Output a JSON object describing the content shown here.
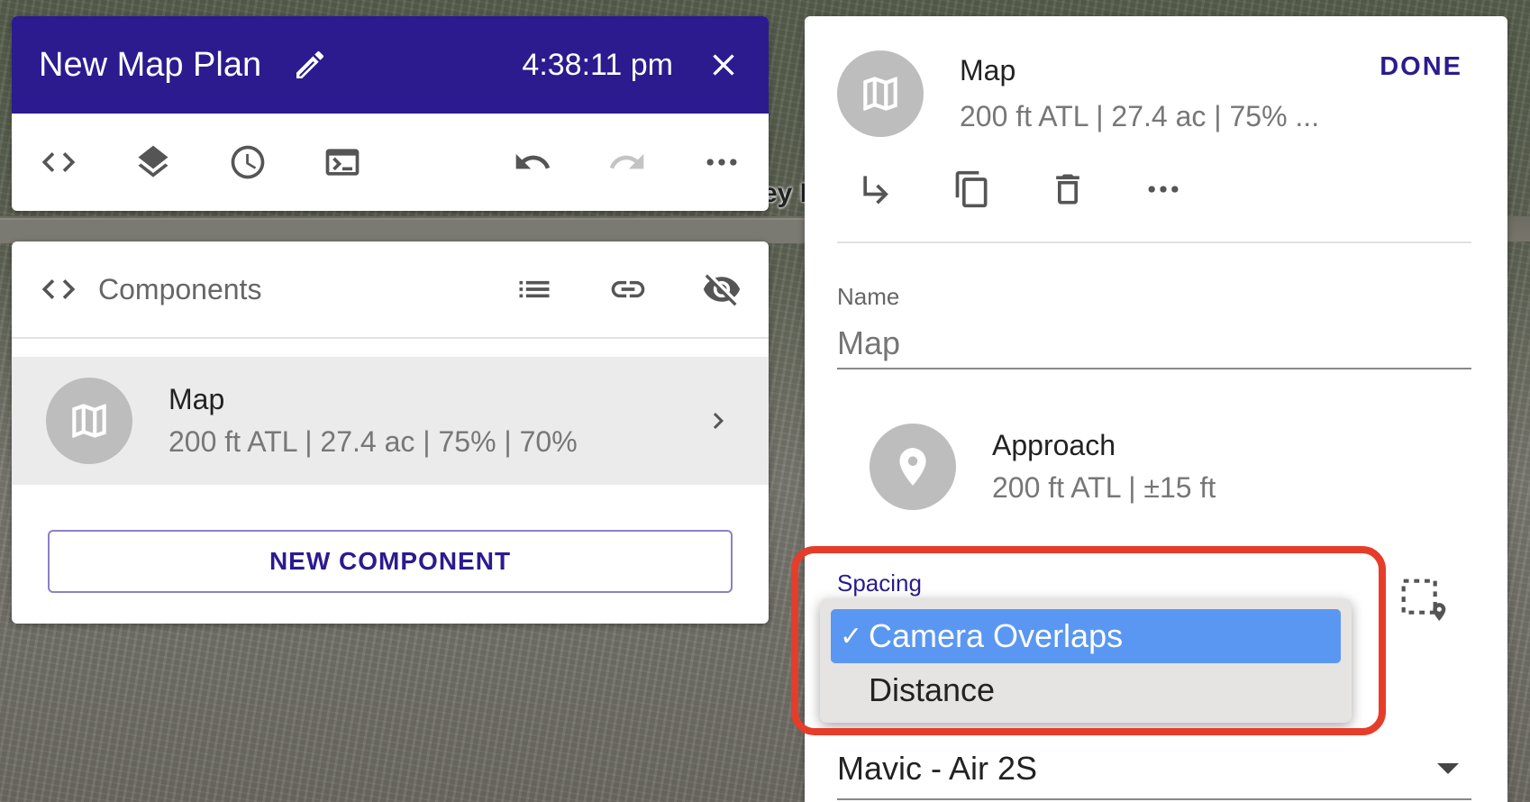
{
  "header": {
    "plan_title": "New Map Plan",
    "clock": "4:38:11 pm"
  },
  "background": {
    "street_label": "ey D"
  },
  "components": {
    "title": "Components",
    "item": {
      "title": "Map",
      "subtitle": "200 ft ATL | 27.4 ac | 75% | 70%"
    },
    "new_button": "NEW COMPONENT"
  },
  "detail": {
    "title": "Map",
    "subtitle": "200 ft ATL | 27.4 ac | 75% ...",
    "done": "DONE",
    "name_label": "Name",
    "name_placeholder": "Map",
    "approach": {
      "title": "Approach",
      "subtitle": "200 ft ATL | ±15 ft"
    },
    "spacing_label": "Spacing",
    "drone_value": "Mavic - Air 2S"
  },
  "dropdown": {
    "check": "✓",
    "options": [
      "Camera Overlaps",
      "Distance"
    ]
  },
  "colors": {
    "primary": "#2b1b8f",
    "highlight": "#e63d2a",
    "selected_option": "#5a97f2"
  }
}
